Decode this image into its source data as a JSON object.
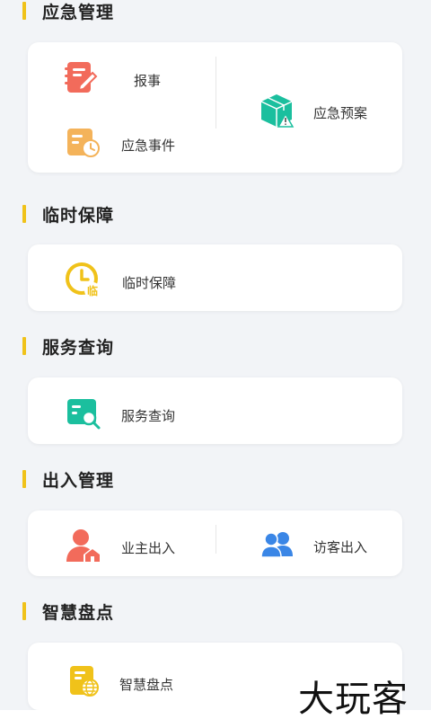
{
  "sections": [
    {
      "title": "应急管理",
      "items": [
        {
          "label": "报事",
          "icon": "notebook-pen-icon"
        },
        {
          "label": "应急预案",
          "icon": "warning-box-icon"
        },
        {
          "label": "应急事件",
          "icon": "document-clock-icon"
        }
      ]
    },
    {
      "title": "临时保障",
      "items": [
        {
          "label": "临时保障",
          "icon": "clock-temp-icon"
        }
      ]
    },
    {
      "title": "服务查询",
      "items": [
        {
          "label": "服务查询",
          "icon": "search-card-icon"
        }
      ]
    },
    {
      "title": "出入管理",
      "items": [
        {
          "label": "业主出入",
          "icon": "owner-home-icon"
        },
        {
          "label": "访客出入",
          "icon": "visitors-icon"
        }
      ]
    },
    {
      "title": "智慧盘点",
      "items": [
        {
          "label": "智慧盘点",
          "icon": "inventory-globe-icon"
        }
      ]
    }
  ],
  "watermark": "大玩客",
  "colors": {
    "accent": "#f0c21a",
    "red": "#f26b5b",
    "teal": "#1bbf9e",
    "orange": "#f4b35a",
    "yellow": "#f0c21a",
    "blue": "#3a86e6"
  }
}
